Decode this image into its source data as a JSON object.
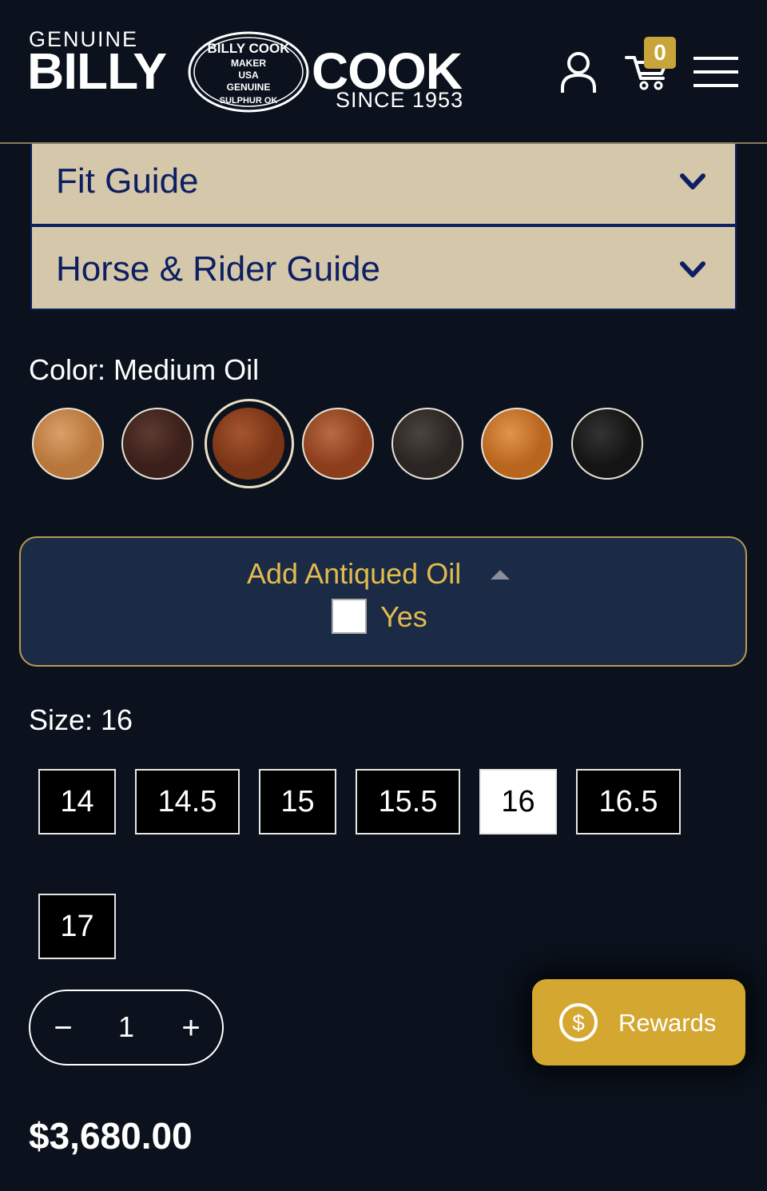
{
  "header": {
    "logo": {
      "genuine": "GENUINE",
      "billy": "BILLY",
      "cook": "COOK",
      "since": "SINCE 1953",
      "seal_lines": [
        "BILLY COOK",
        "MAKER",
        "USA",
        "GENUINE",
        "SULPHUR OK"
      ]
    },
    "cart_count": "0",
    "icons": [
      "account-icon",
      "cart-icon",
      "menu-icon"
    ]
  },
  "accordions": [
    {
      "label": "Fit Guide"
    },
    {
      "label": "Horse & Rider Guide"
    }
  ],
  "color": {
    "label": "Color: Medium Oil",
    "selected_index": 2,
    "swatches": [
      {
        "name": "swatch-1",
        "base": "#b8763a",
        "light": "#d9a06a"
      },
      {
        "name": "swatch-2",
        "base": "#3b1f1a",
        "light": "#5c3a30"
      },
      {
        "name": "swatch-3",
        "base": "#7a3416",
        "light": "#a5552e"
      },
      {
        "name": "swatch-4",
        "base": "#8c3e1c",
        "light": "#b76a44"
      },
      {
        "name": "swatch-5",
        "base": "#2a2522",
        "light": "#4a443e"
      },
      {
        "name": "swatch-6",
        "base": "#b8651e",
        "light": "#e0944c"
      },
      {
        "name": "swatch-7",
        "base": "#141414",
        "light": "#333333"
      }
    ]
  },
  "antique": {
    "title": "Add Antiqued Oil",
    "option": "Yes",
    "checked": false
  },
  "size": {
    "label": "Size: 16",
    "options": [
      "14",
      "14.5",
      "15",
      "15.5",
      "16",
      "16.5",
      "17"
    ],
    "selected": "16"
  },
  "quantity": {
    "minus": "−",
    "value": "1",
    "plus": "+"
  },
  "rewards": {
    "label": "Rewards"
  },
  "price": "$3,680.00",
  "colors": {
    "background": "#0b121d",
    "accordion_bg": "#d5c7a9",
    "accordion_text": "#0c1f63",
    "gold": "#d4a730",
    "panel_bg": "#1b2b45"
  }
}
